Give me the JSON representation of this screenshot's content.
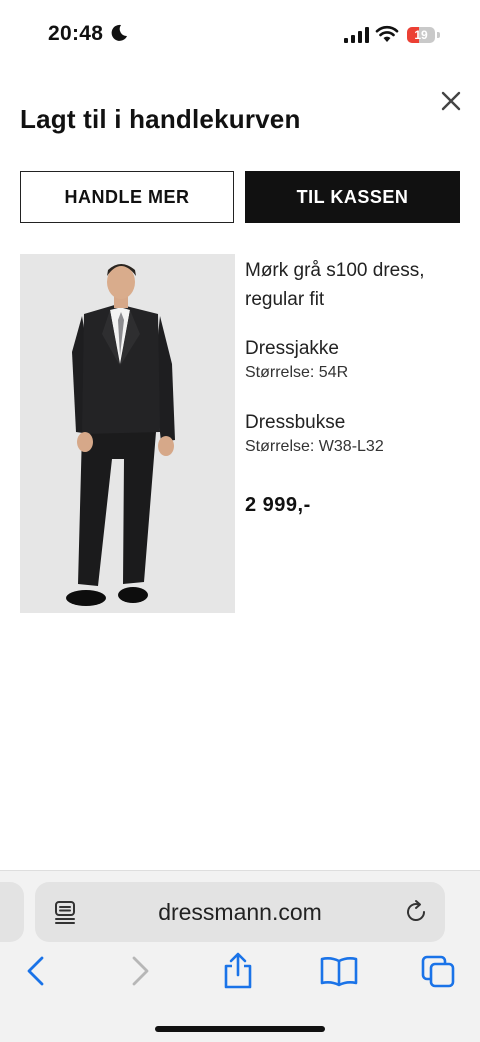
{
  "status_bar": {
    "time": "20:48",
    "battery": "19"
  },
  "modal": {
    "title": "Lagt til i handlekurven",
    "continue_label": "HANDLE MER",
    "checkout_label": "TIL KASSEN"
  },
  "product": {
    "name": "Mørk grå s100 dress, regular fit",
    "items": [
      {
        "name": "Dressjakke",
        "size": "Størrelse: 54R"
      },
      {
        "name": "Dressbukse",
        "size": "Størrelse: W38-L32"
      }
    ],
    "price": "2 999,-"
  },
  "browser": {
    "url": "dressmann.com"
  },
  "colors": {
    "accent": "#111111",
    "link_blue": "#1a73e8"
  },
  "icons": [
    "moon-icon",
    "signal-icon",
    "wifi-icon",
    "battery-icon",
    "close-icon",
    "reader-icon",
    "reload-icon",
    "back-icon",
    "forward-icon",
    "share-icon",
    "bookmarks-icon",
    "tabs-icon"
  ]
}
